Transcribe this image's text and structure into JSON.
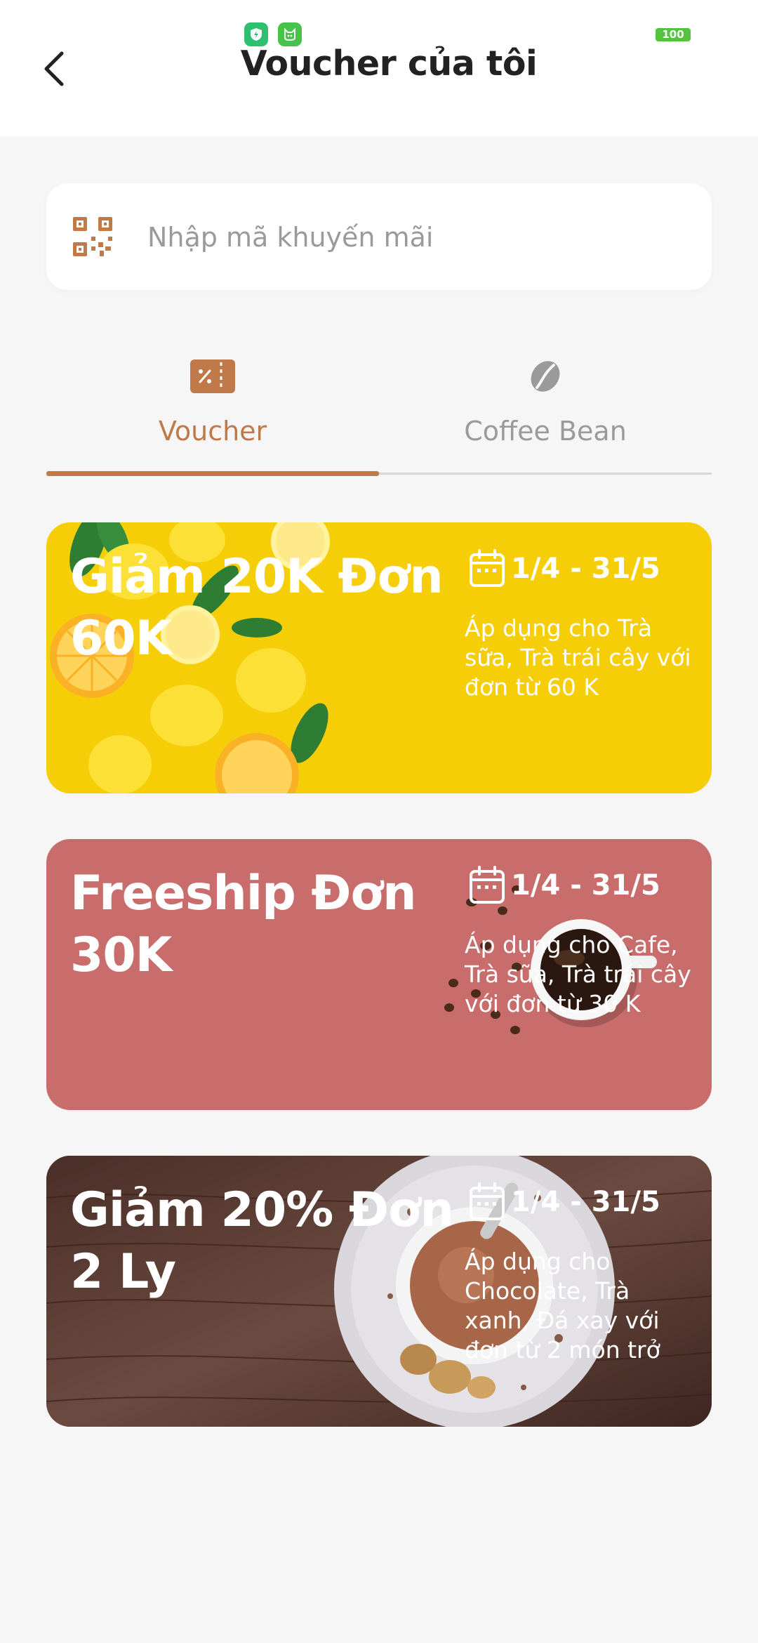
{
  "status_bar": {
    "battery": "100"
  },
  "header": {
    "title": "Voucher của tôi"
  },
  "promo_input": {
    "placeholder": "Nhập mã khuyến mãi"
  },
  "tabs": [
    {
      "label": "Voucher",
      "icon": "voucher-icon",
      "active": true
    },
    {
      "label": "Coffee Bean",
      "icon": "coffee-bean-icon",
      "active": false
    }
  ],
  "vouchers": [
    {
      "title": "Giảm 20K Đơn 60K",
      "date": "1/4 - 31/5",
      "description": "Áp dụng cho Trà sữa, Trà trái cây với đơn từ 60 K",
      "color": "#f6ce08",
      "image": "lemons"
    },
    {
      "title": "Freeship Đơn 30K",
      "date": "1/4 - 31/5",
      "description": "Áp dụng cho Cafe, Trà sữa, Trà trái cây với đơn từ 30 K",
      "color": "#c96c6c",
      "image": "coffee-cup"
    },
    {
      "title": "Giảm 20% Đơn 2 Ly",
      "date": "1/4 - 31/5",
      "description": "Áp dụng cho Chocolate, Trà xanh, Đá xay với đơn từ 2 món trở",
      "color": "#5a3c34",
      "image": "hot-chocolate"
    }
  ],
  "colors": {
    "accent": "#c07a4a",
    "inactive": "#9a9a9a",
    "background": "#f6f6f6"
  }
}
